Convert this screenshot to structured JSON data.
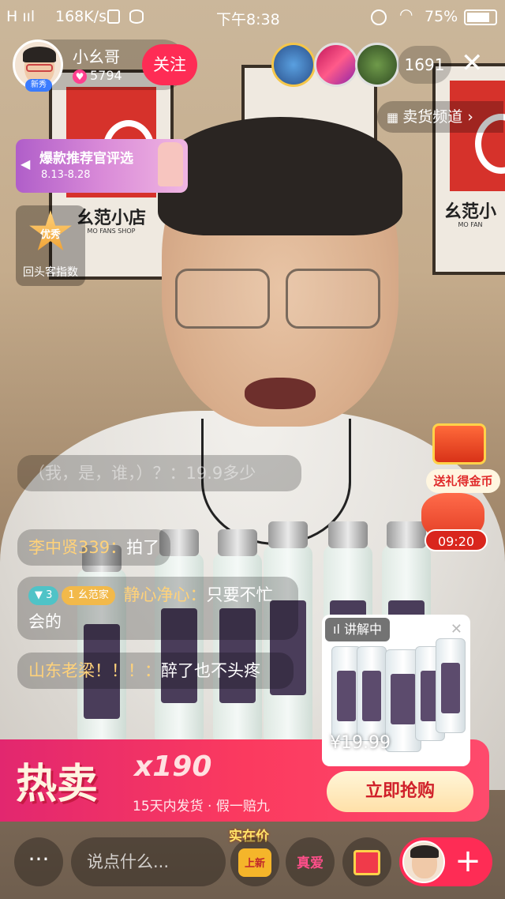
{
  "status_bar": {
    "signal": "H ııl",
    "speed": "168K/s",
    "time": "下午8:38",
    "battery": "75%"
  },
  "host": {
    "name": "小幺哥",
    "badge": "新秀",
    "likes": "5794",
    "follow_label": "关注"
  },
  "viewers": {
    "count": "1691"
  },
  "channel": {
    "label": "卖货频道"
  },
  "backdrop": {
    "shop_name": "幺范小店",
    "shop_en": "MO FANS SHOP",
    "shop_name_right": "幺范小",
    "shop_en_right": "MO FAN"
  },
  "event_banner": {
    "title": "爆款推荐官评选",
    "dates": "8.13-8.28"
  },
  "quality_badge": {
    "star": "优秀",
    "label": "回头客指数"
  },
  "chat": [
    {
      "text": "（我，是，谁，）？：19.9多少"
    },
    {
      "user": "李中贤339：",
      "text": "拍了"
    },
    {
      "level": "3",
      "fan_level": "1",
      "fan_club": "幺范家",
      "user": "静心净心：",
      "text": "只要不忙会的"
    },
    {
      "user": "山东老梁！！！：",
      "text": "醉了也不头疼"
    }
  ],
  "gift": {
    "label": "送礼得金币",
    "timer": "09:20"
  },
  "product_card": {
    "tag": "讲解中",
    "price": "¥19.99"
  },
  "hot_sale": {
    "title": "热卖",
    "count": "x190",
    "subtitle": "15天内发货 · 假一赔九",
    "buy_label": "立即抢购"
  },
  "bottom": {
    "more": "···",
    "input_placeholder": "说点什么...",
    "real_price": "实在价",
    "new_label": "上新",
    "love_label": "真爱",
    "plus": "+"
  },
  "colors": {
    "accent": "#fe2c55",
    "hot_gradient": "#fb3a5f",
    "gold": "#ffd27a"
  }
}
